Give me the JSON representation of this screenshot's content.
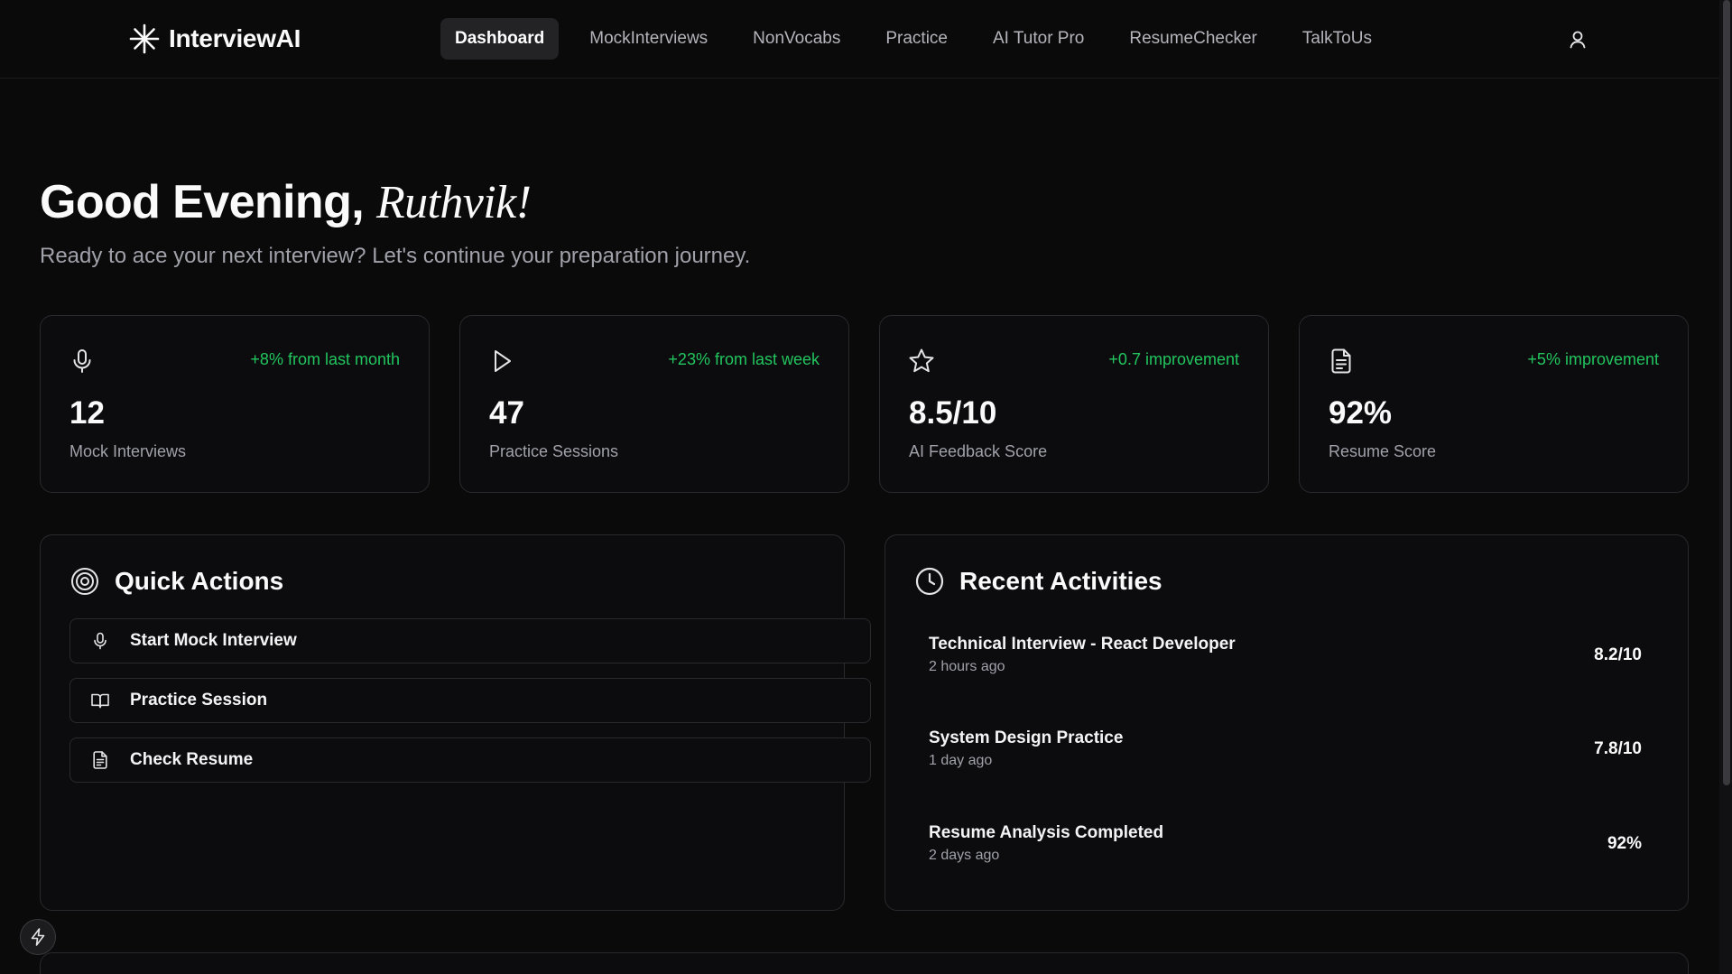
{
  "brand": {
    "name": "InterviewAI"
  },
  "nav": {
    "items": [
      {
        "label": "Dashboard",
        "active": true
      },
      {
        "label": "MockInterviews"
      },
      {
        "label": "NonVocabs"
      },
      {
        "label": "Practice"
      },
      {
        "label": "AI Tutor Pro"
      },
      {
        "label": "ResumeChecker"
      },
      {
        "label": "TalkToUs"
      }
    ]
  },
  "greeting": {
    "prefix": "Good Evening, ",
    "name": "Ruthvik!",
    "subtitle": "Ready to ace your next interview? Let's continue your preparation journey."
  },
  "stats": [
    {
      "icon": "microphone-icon",
      "trend": "+8% from last month",
      "value": "12",
      "label": "Mock Interviews"
    },
    {
      "icon": "play-icon",
      "trend": "+23% from last week",
      "value": "47",
      "label": "Practice Sessions"
    },
    {
      "icon": "star-icon",
      "trend": "+0.7 improvement",
      "value": "8.5/10",
      "label": "AI Feedback Score"
    },
    {
      "icon": "document-icon",
      "trend": "+5% improvement",
      "value": "92%",
      "label": "Resume Score"
    }
  ],
  "quick_actions": {
    "title": "Quick Actions",
    "icon": "target-icon",
    "items": [
      {
        "label": "Start Mock Interview",
        "icon": "microphone-icon"
      },
      {
        "label": "Practice Session",
        "icon": "book-icon"
      },
      {
        "label": "Check Resume",
        "icon": "document-icon"
      }
    ]
  },
  "recent_activities": {
    "title": "Recent Activities",
    "icon": "clock-icon",
    "items": [
      {
        "title": "Technical Interview - React Developer",
        "time": "2 hours ago",
        "score": "8.2/10"
      },
      {
        "title": "System Design Practice",
        "time": "1 day ago",
        "score": "7.8/10"
      },
      {
        "title": "Resume Analysis Completed",
        "time": "2 days ago",
        "score": "92%"
      }
    ]
  },
  "colors": {
    "background": "#0a0a0b",
    "accent_green": "#22c55e",
    "border": "#2a2a2e",
    "active_nav": "#232326"
  }
}
